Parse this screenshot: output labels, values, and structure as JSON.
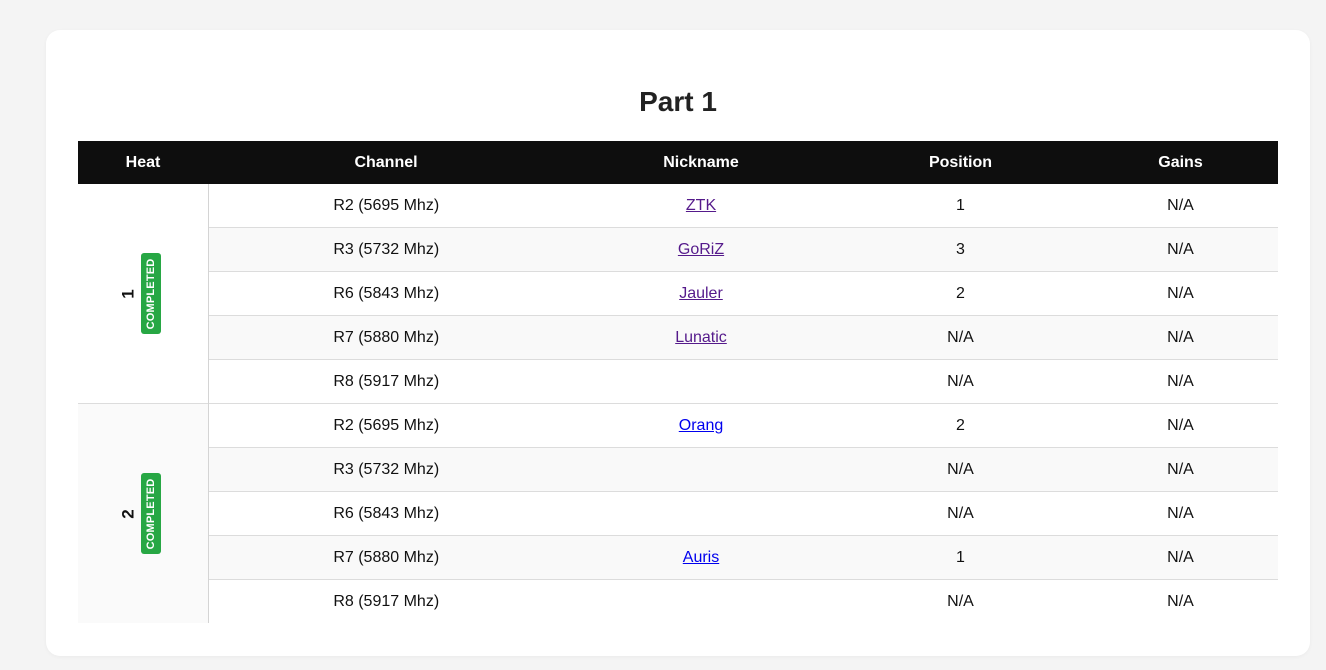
{
  "page": {
    "title": "Part 1"
  },
  "table": {
    "headers": {
      "heat": "Heat",
      "channel": "Channel",
      "nickname": "Nickname",
      "position": "Position",
      "gains": "Gains"
    },
    "heats": [
      {
        "number": "1",
        "status": "COMPLETED",
        "rows": [
          {
            "channel": "R2 (5695 Mhz)",
            "nickname": "ZTK",
            "nick_visited": true,
            "position": "1",
            "gains": "N/A"
          },
          {
            "channel": "R3 (5732 Mhz)",
            "nickname": "GoRiZ",
            "nick_visited": true,
            "position": "3",
            "gains": "N/A"
          },
          {
            "channel": "R6 (5843 Mhz)",
            "nickname": "Jauler",
            "nick_visited": true,
            "position": "2",
            "gains": "N/A"
          },
          {
            "channel": "R7 (5880 Mhz)",
            "nickname": "Lunatic",
            "nick_visited": true,
            "position": "N/A",
            "gains": "N/A"
          },
          {
            "channel": "R8 (5917 Mhz)",
            "nickname": "",
            "nick_visited": false,
            "position": "N/A",
            "gains": "N/A"
          }
        ]
      },
      {
        "number": "2",
        "status": "COMPLETED",
        "rows": [
          {
            "channel": "R2 (5695 Mhz)",
            "nickname": "Orang",
            "nick_visited": false,
            "position": "2",
            "gains": "N/A"
          },
          {
            "channel": "R3 (5732 Mhz)",
            "nickname": "",
            "nick_visited": false,
            "position": "N/A",
            "gains": "N/A"
          },
          {
            "channel": "R6 (5843 Mhz)",
            "nickname": "",
            "nick_visited": false,
            "position": "N/A",
            "gains": "N/A"
          },
          {
            "channel": "R7 (5880 Mhz)",
            "nickname": "Auris",
            "nick_visited": false,
            "position": "1",
            "gains": "N/A"
          },
          {
            "channel": "R8 (5917 Mhz)",
            "nickname": "",
            "nick_visited": false,
            "position": "N/A",
            "gains": "N/A"
          }
        ]
      }
    ]
  },
  "colors": {
    "header_bg": "#0e0e0e",
    "badge_bg": "#27a744",
    "link_visited": "#551a8b",
    "link_unvisited": "#0000ee"
  }
}
